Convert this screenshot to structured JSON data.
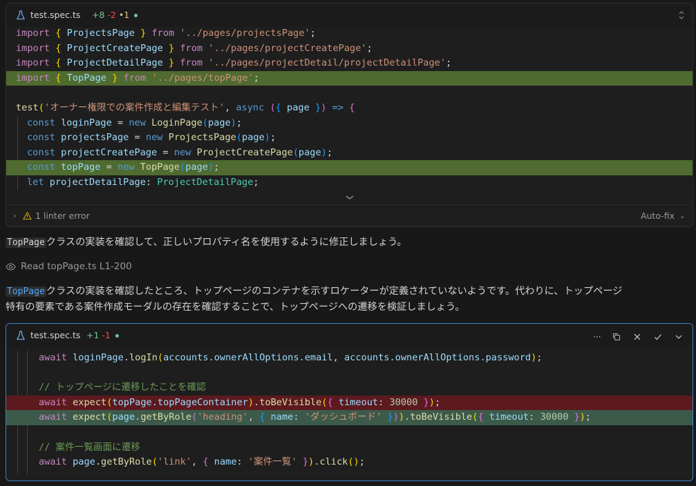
{
  "card1": {
    "filename": "test.spec.ts",
    "added": "+8",
    "removed": "-2",
    "modified": "•1",
    "linter": "1 linter error",
    "autofix": "Auto-fix"
  },
  "card1_code": [
    [
      "import ",
      "{ ",
      "ProjectsPage",
      " }",
      " from ",
      "'../pages/projectsPage'",
      ";"
    ],
    [
      "import ",
      "{ ",
      "ProjectCreatePage",
      " }",
      " from ",
      "'../pages/projectCreatePage'",
      ";"
    ],
    [
      "import ",
      "{ ",
      "ProjectDetailPage",
      " }",
      " from ",
      "'../pages/projectDetail/projectDetailPage'",
      ";"
    ],
    [
      "import ",
      "{ ",
      "TopPage",
      " }",
      " from ",
      "'../pages/topPage'",
      ";"
    ]
  ],
  "test_line": {
    "fn": "test",
    "open": "(",
    "name": "'オーナー権限での案件作成と編集テスト'",
    "comma": ", ",
    "async": "async ",
    "args_open": "(",
    "brace_open": "{ ",
    "param": "page",
    "brace_close": " }",
    "args_close": ")",
    "arrow": " => ",
    "body_open": "{"
  },
  "consts": [
    {
      "kw": "const ",
      "name": "loginPage",
      "eq": " = ",
      "new": "new ",
      "cls": "LoginPage",
      "arg": "page"
    },
    {
      "kw": "const ",
      "name": "projectsPage",
      "eq": " = ",
      "new": "new ",
      "cls": "ProjectsPage",
      "arg": "page"
    },
    {
      "kw": "const ",
      "name": "projectCreatePage",
      "eq": " = ",
      "new": "new ",
      "cls": "ProjectCreatePage",
      "arg": "page"
    },
    {
      "kw": "const ",
      "name": "topPage",
      "eq": " = ",
      "new": "new ",
      "cls": "TopPage",
      "arg": "page"
    }
  ],
  "let_line": {
    "kw": "let ",
    "name": "projectDetailPage",
    "colon": ": ",
    "type": "ProjectDetailPage",
    "semi": ";"
  },
  "msg1": {
    "code": "TopPage",
    "text": "クラスの実装を確認して、正しいプロパティ名を使用するように修正しましょう。"
  },
  "read": {
    "label": "Read topPage.ts L1-200"
  },
  "msg2": {
    "code": "TopPage",
    "text1": "クラスの実装を確認したところ、トップページのコンテナを示すロケーターが定義されていないようです。代わりに、トップページ",
    "text2": "特有の要素である案件作成モーダルの存在を確認することで、トップページへの遷移を検証しましょう。"
  },
  "card2": {
    "filename": "test.spec.ts",
    "added": "+1",
    "removed": "-1",
    "more": "···"
  },
  "card2_code": {
    "l1": {
      "await": "await ",
      "obj": "loginPage",
      "dot": ".",
      "fn": "logIn",
      "open": "(",
      "a1": "accounts",
      "a1b": ".ownerAllOptions",
      "a1c": ".email",
      "comma": ", ",
      "a2": "accounts",
      "a2b": ".ownerAllOptions",
      "a2c": ".password",
      "close": ")",
      "semi": ";"
    },
    "c1": "// トップページに遷移したことを確認",
    "del": {
      "await": "await ",
      "fn": "expect",
      "open": "(",
      "obj": "topPage",
      "prop": ".topPageContainer",
      "close": ")",
      "dot": ".",
      "fn2": "toBeVisible",
      "open2": "(",
      "bo": "{ ",
      "key": "timeout",
      "colon": ": ",
      "num": "30000",
      "bc": " }",
      "close2": ")",
      "semi": ";"
    },
    "add": {
      "await": "await ",
      "fn": "expect",
      "open": "(",
      "obj": "page",
      "dot": ".",
      "m": "getByRole",
      "open2": "(",
      "s1": "'heading'",
      "comma": ", ",
      "bo": "{ ",
      "key": "name",
      "colon": ": ",
      "s2": "'ダッシュボード'",
      "bc": " }",
      "close2": ")",
      "close": ")",
      "dot2": ".",
      "fn2": "toBeVisible",
      "open3": "(",
      "bo2": "{ ",
      "key2": "timeout",
      "colon2": ": ",
      "num": "30000",
      "bc2": " }",
      "close3": ")",
      "semi": ";"
    },
    "c2": "// 案件一覧画面に遷移",
    "l2": {
      "await": "await ",
      "obj": "page",
      "dot": ".",
      "m": "getByRole",
      "open": "(",
      "s1": "'link'",
      "comma": ", ",
      "bo": "{ ",
      "key": "name",
      "colon": ": ",
      "s2": "'案件一覧'",
      "bc": " }",
      "close": ")",
      "dot2": ".",
      "fn2": "click",
      "open2": "(",
      "close2": ")",
      "semi": ";"
    }
  }
}
